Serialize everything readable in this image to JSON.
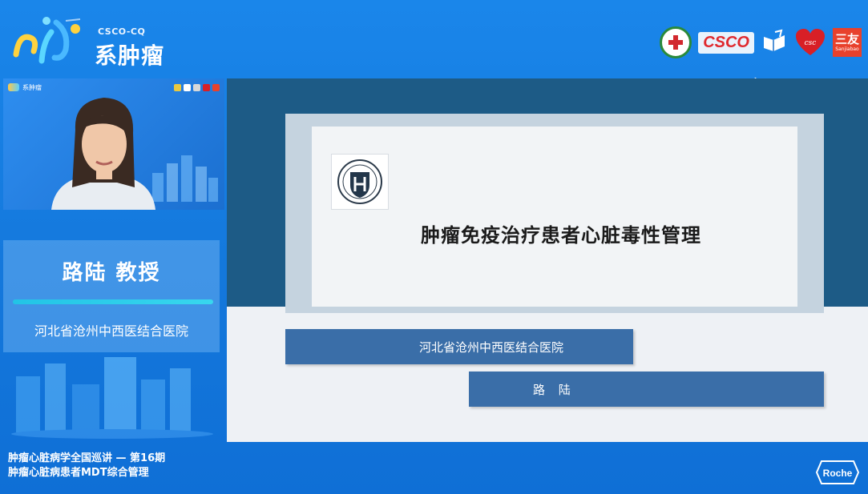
{
  "header": {
    "brand_small": "CSCO-CQ",
    "brand_title": "系肿瘤",
    "logos": {
      "csco_text": "CSCO",
      "sanjia_main": "三友",
      "sanjia_sub": "Sanjiabao"
    }
  },
  "video": {
    "mini_title": "系肿瘤"
  },
  "speaker": {
    "name": "路陆 教授",
    "hospital": "河北省沧州中西医结合医院"
  },
  "footer": {
    "line1": "肿瘤心脏病学全国巡讲 — 第16期",
    "line2": "肿瘤心脏病患者MDT综合管理",
    "sponsor": "Roche"
  },
  "slide": {
    "title": "肿瘤免疫治疗患者心脏毒性管理",
    "hospital": "河北省沧州中西医结合医院",
    "speaker": "路 陆"
  },
  "colors": {
    "background": "#1478dc",
    "slide_band": "#1d5b86",
    "slide_bar": "#3a6ea8",
    "accent_line": "#22c4e6"
  },
  "icons": [
    "brand-heart-logo",
    "hospital-logo",
    "csco-logo",
    "book-logo",
    "heart-logo",
    "sanjia-logo",
    "roche-logo",
    "cursor-icon"
  ]
}
